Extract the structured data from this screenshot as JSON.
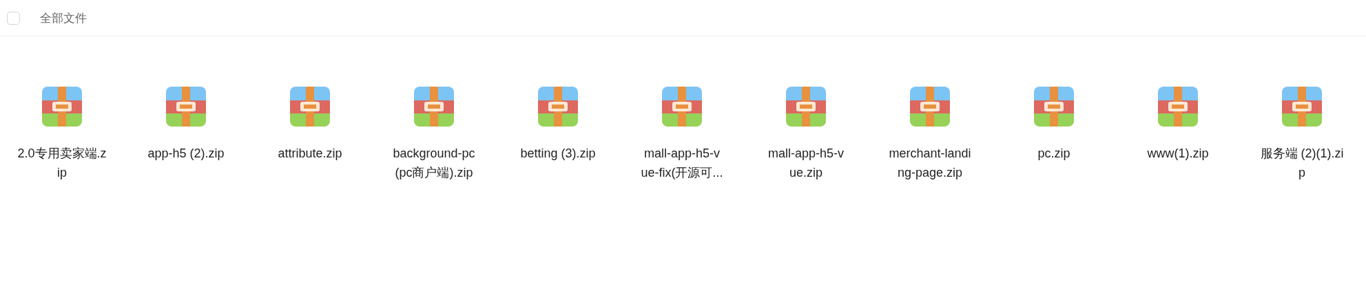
{
  "header": {
    "select_all": {
      "checked": false
    },
    "title": "全部文件"
  },
  "files": [
    {
      "name_lines": [
        "2.0专用卖家端.z",
        "ip"
      ]
    },
    {
      "name_lines": [
        "app-h5 (2).zip"
      ]
    },
    {
      "name_lines": [
        "attribute.zip"
      ]
    },
    {
      "name_lines": [
        "background-pc",
        "(pc商户端).zip"
      ]
    },
    {
      "name_lines": [
        "betting (3).zip"
      ]
    },
    {
      "name_lines": [
        "mall-app-h5-v",
        "ue-fix(开源可..."
      ]
    },
    {
      "name_lines": [
        "mall-app-h5-v",
        "ue.zip"
      ]
    },
    {
      "name_lines": [
        "merchant-landi",
        "ng-page.zip"
      ]
    },
    {
      "name_lines": [
        "pc.zip"
      ]
    },
    {
      "name_lines": [
        "www(1).zip"
      ]
    },
    {
      "name_lines": [
        "服务端 (2)(1).zi",
        "p"
      ]
    }
  ]
}
